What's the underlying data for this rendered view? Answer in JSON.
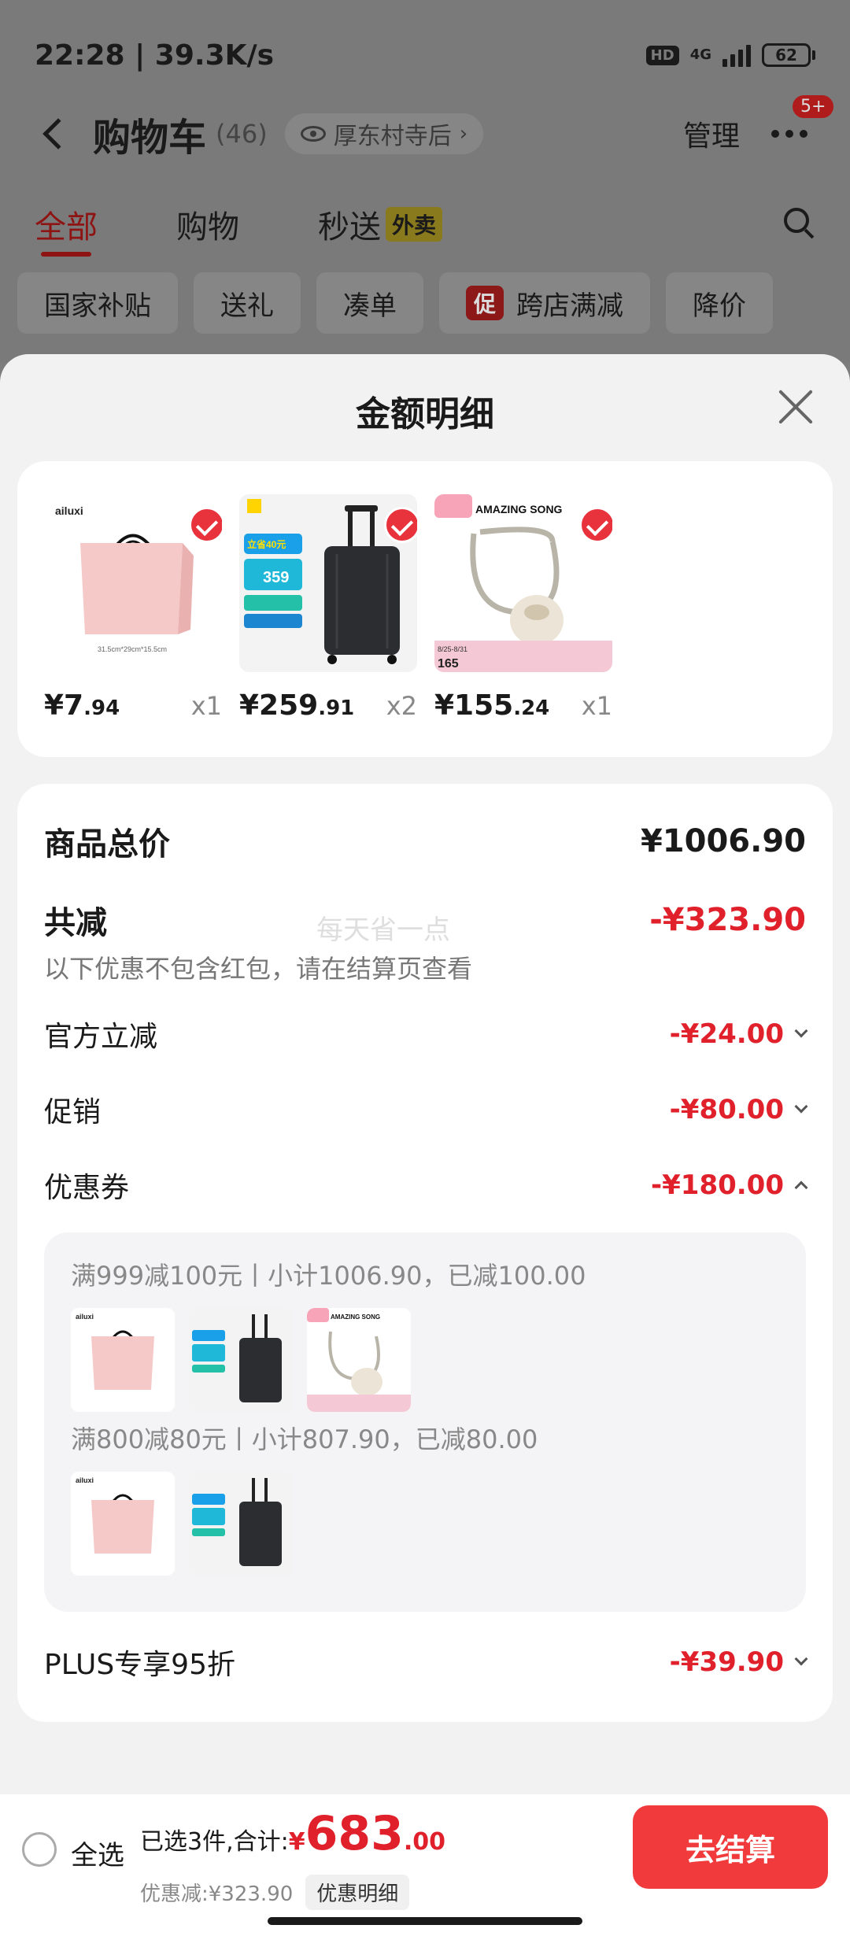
{
  "status_bar": {
    "time_speed": "22:28 | 39.3K/s",
    "hd": "HD",
    "network": "4G",
    "battery": "62"
  },
  "cart_header": {
    "title": "购物车",
    "count": "(46)",
    "location": "厚东村寺后",
    "manage": "管理",
    "badge": "5+"
  },
  "tabs": [
    {
      "label": "全部"
    },
    {
      "label": "购物"
    },
    {
      "label": "秒送",
      "tag": "外卖"
    }
  ],
  "filters": [
    "国家补贴",
    "送礼",
    "凑单",
    "跨店满减",
    "降价"
  ],
  "promo_tag": "促",
  "sheet": {
    "title": "金额明细",
    "products": [
      {
        "brand": "ailuxi",
        "size_note": "31.5cm*29cm*15.5cm",
        "price_int": "¥7",
        "price_dec": ".94",
        "qty": "x1"
      },
      {
        "promo_text": "立省40元",
        "promo_price": "359",
        "price_int": "¥259",
        "price_dec": ".91",
        "qty": "x2"
      },
      {
        "brand": "AMAZING SONG",
        "date_range": "8/25-8/31",
        "promo_price": "165",
        "price_int": "¥155",
        "price_dec": ".24",
        "qty": "x1"
      }
    ],
    "subtotal_label": "商品总价",
    "subtotal_value": "¥1006.90",
    "total_discount_label": "共减",
    "total_discount_value": "-¥323.90",
    "note": "以下优惠不包含红包，请在结算页查看",
    "watermark": "每天省一点",
    "lines": [
      {
        "label": "官方立减",
        "value": "-¥24.00"
      },
      {
        "label": "促销",
        "value": "-¥80.00"
      },
      {
        "label": "优惠券",
        "value": "-¥180.00"
      }
    ],
    "coupons": [
      {
        "text": "满999减100元丨小计1006.90，已减100.00"
      },
      {
        "text": "满800减80元丨小计807.90，已减80.00"
      }
    ],
    "plus_label": "PLUS专享95折",
    "plus_value": "-¥39.90"
  },
  "bottom_bar": {
    "select_all": "全选",
    "summary": "已选3件,合计:",
    "currency": "¥",
    "total_int": "683",
    "total_dec": ".00",
    "discount": "优惠减:¥323.90",
    "detail_button": "优惠明细",
    "checkout": "去结算"
  },
  "colors": {
    "accent_red": "#e0202a",
    "checkout_red": "#f03a3c",
    "overlay_gray": "#7a7a7a",
    "sheet_bg": "#f2f2f2"
  }
}
